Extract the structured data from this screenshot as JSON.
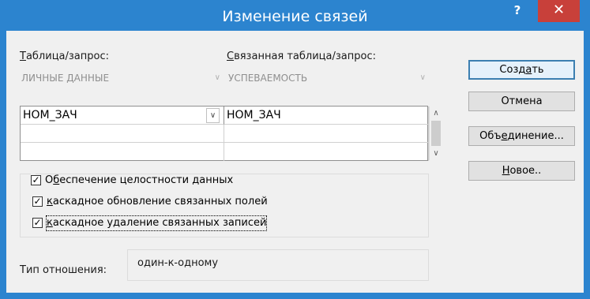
{
  "window": {
    "title": "Изменение связей",
    "help_label": "?",
    "close_label": "✕"
  },
  "labels": {
    "table_pre": "",
    "table_u": "Т",
    "table_post": "аблица/запрос:",
    "related_pre": "",
    "related_u": "С",
    "related_post": "вязанная таблица/запрос:"
  },
  "combos": {
    "table_value": "ЛИЧНЫЕ ДАННЫЕ",
    "related_value": "УСПЕВАЕМОСТЬ"
  },
  "grid": {
    "rows": [
      {
        "left": "НОМ_ЗАЧ",
        "right": "НОМ_ЗАЧ"
      },
      {
        "left": "",
        "right": ""
      },
      {
        "left": "",
        "right": ""
      }
    ]
  },
  "buttons": {
    "create_pre": "Созд",
    "create_u": "а",
    "create_post": "ть",
    "cancel": "Отмена",
    "join_pre": "Объ",
    "join_u": "е",
    "join_post": "динение...",
    "new_pre": "",
    "new_u": "Н",
    "new_post": "овое.."
  },
  "checks": {
    "integrity_pre": "О",
    "integrity_u": "б",
    "integrity_post": "еспечение целостности данных",
    "cascade_update_pre": "",
    "cascade_update_u": "к",
    "cascade_update_post": "аскадное обновление связанных полей",
    "cascade_delete_pre": "",
    "cascade_delete_u": "к",
    "cascade_delete_post": "аскадное удаление связанных записей"
  },
  "relationship": {
    "label": "Тип отношения:",
    "value": "один-к-одному"
  }
}
